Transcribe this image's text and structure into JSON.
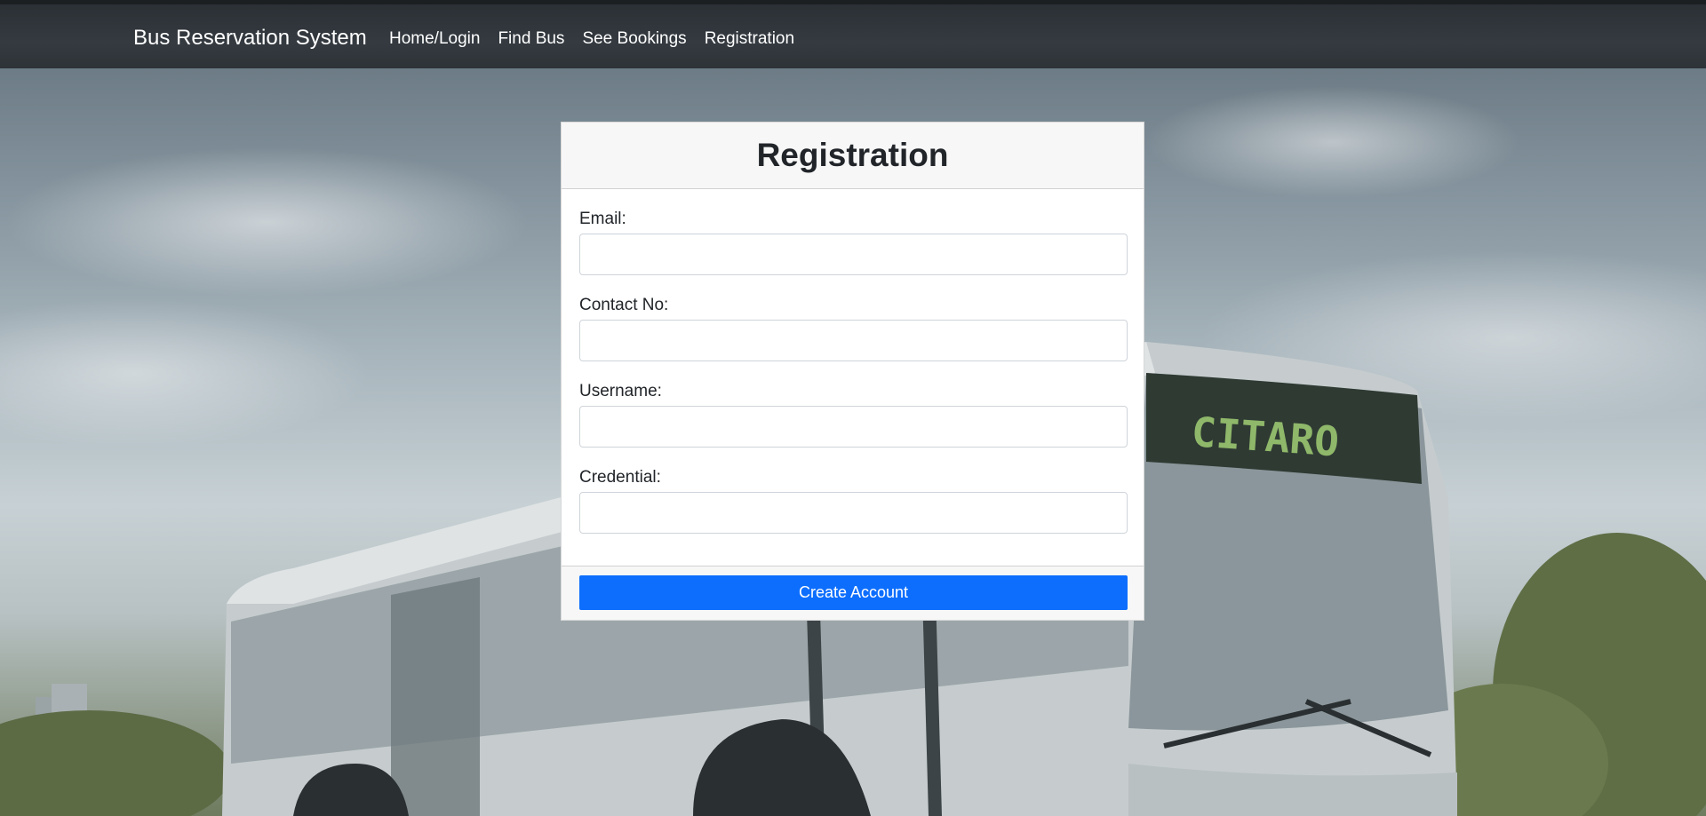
{
  "navbar": {
    "brand": "Bus Reservation System",
    "links": [
      {
        "label": "Home/Login"
      },
      {
        "label": "Find Bus"
      },
      {
        "label": "See Bookings"
      },
      {
        "label": "Registration"
      }
    ]
  },
  "background": {
    "bus_sign_text": "CITARO"
  },
  "form": {
    "title": "Registration",
    "fields": [
      {
        "label": "Email:",
        "value": "",
        "placeholder": ""
      },
      {
        "label": "Contact No:",
        "value": "",
        "placeholder": ""
      },
      {
        "label": "Username:",
        "value": "",
        "placeholder": ""
      },
      {
        "label": "Credential:",
        "value": "",
        "placeholder": ""
      }
    ],
    "submit_label": "Create Account"
  },
  "colors": {
    "navbar_bg": "#343a40",
    "primary_button": "#0d6efd"
  }
}
